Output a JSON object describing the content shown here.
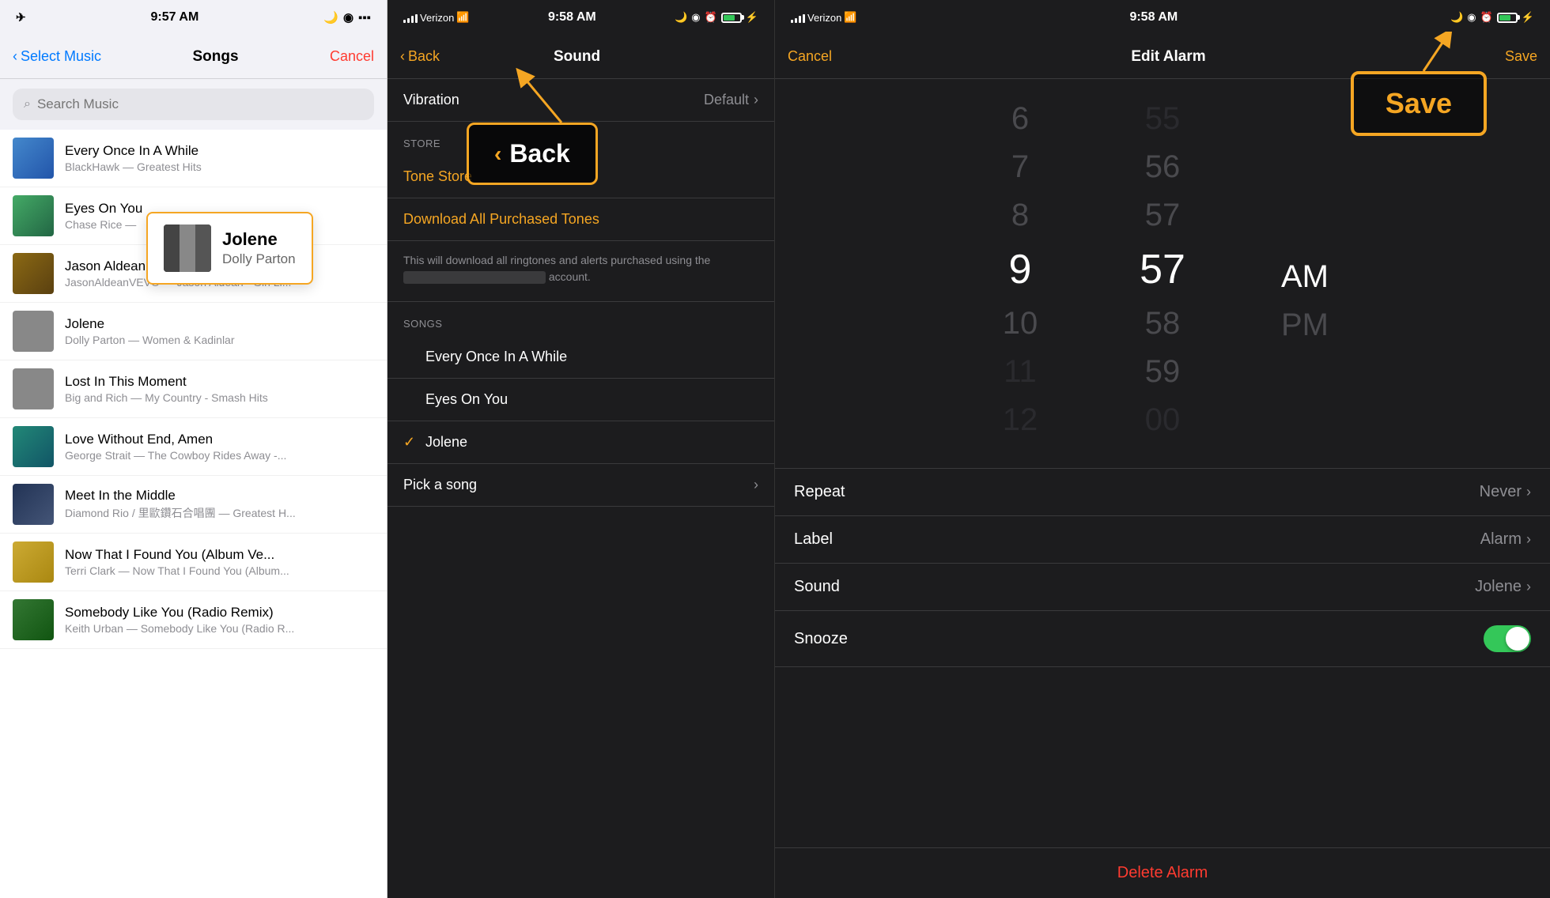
{
  "panel1": {
    "statusBar": {
      "time": "9:57 AM",
      "airplane": "✈"
    },
    "nav": {
      "back": "Select Music",
      "title": "Songs",
      "cancel": "Cancel"
    },
    "search": {
      "placeholder": "Search Music"
    },
    "songs": [
      {
        "id": "s1",
        "title": "Every Once In A While",
        "subtitle": "BlackHawk — Greatest Hits",
        "thumbColor": "thumb-blue"
      },
      {
        "id": "s2",
        "title": "Eyes On You",
        "subtitle": "Chase Rice — ...",
        "thumbColor": "thumb-green"
      },
      {
        "id": "s3",
        "title": "Jason Aldean - Girl Like You (Offi...",
        "subtitle": "JasonAldeanVEVO — Jason Aldean - Girl Li...",
        "thumbColor": "thumb-brown"
      },
      {
        "id": "s4",
        "title": "Jolene",
        "subtitle": "Dolly Parton — Women & Kadinlar",
        "thumbColor": "thumb-gray"
      },
      {
        "id": "s5",
        "title": "Lost In This Moment",
        "subtitle": "Big and Rich — My Country - Smash Hits",
        "thumbColor": "thumb-gray"
      },
      {
        "id": "s6",
        "title": "Love Without End, Amen",
        "subtitle": "George Strait — The Cowboy Rides Away -...",
        "thumbColor": "thumb-teal"
      },
      {
        "id": "s7",
        "title": "Meet In the Middle",
        "subtitle": "Diamond Rio / 里歐鑽石合唱團 — Greatest H...",
        "thumbColor": "thumb-diamond"
      },
      {
        "id": "s8",
        "title": "Now That I Found You (Album Ve...",
        "subtitle": "Terri Clark — Now That I Found You (Album...",
        "thumbColor": "thumb-yellow"
      },
      {
        "id": "s9",
        "title": "Somebody Like You (Radio Remix)",
        "subtitle": "Keith Urban — Somebody Like You (Radio R...",
        "thumbColor": "thumb-country"
      }
    ],
    "tooltip": {
      "title": "Jolene",
      "artist": "Dolly Parton"
    }
  },
  "panel2": {
    "statusBar": {
      "carrier": "Verizon",
      "time": "9:58 AM"
    },
    "nav": {
      "back": "Back",
      "title": "Sound"
    },
    "vibration": {
      "label": "Vibration",
      "value": "Default"
    },
    "sections": {
      "store": "STORE",
      "songs": "SONGS"
    },
    "toneStore": "Tone Store",
    "downloadAll": "Download All Purchased Tones",
    "description": "This will download all ringtones and alerts purchased using the account.",
    "songs": [
      {
        "id": "so1",
        "name": "Every Once In A While",
        "checked": false
      },
      {
        "id": "so2",
        "name": "Eyes On You",
        "checked": false
      },
      {
        "id": "so3",
        "name": "Jolene",
        "checked": true
      },
      {
        "id": "so4",
        "name": "Pick a song",
        "checked": false,
        "hasChevron": true
      }
    ],
    "annotations": {
      "backLabel": "Back"
    }
  },
  "panel3": {
    "statusBar": {
      "carrier": "Verizon",
      "time": "9:58 AM"
    },
    "nav": {
      "cancel": "Cancel",
      "title": "Edit Alarm",
      "save": "Save"
    },
    "timePicker": {
      "hours": [
        "6",
        "7",
        "8",
        "9",
        "10",
        "11",
        "12"
      ],
      "minutes": [
        "55",
        "56",
        "57",
        "58",
        "59",
        "00"
      ],
      "periods": [
        "AM",
        "PM"
      ],
      "selectedHour": "9",
      "selectedMinute": "57",
      "selectedPeriod": "AM"
    },
    "settings": [
      {
        "id": "repeat",
        "label": "Repeat",
        "value": "Never",
        "type": "nav"
      },
      {
        "id": "label",
        "label": "Label",
        "value": "Alarm",
        "type": "nav"
      },
      {
        "id": "sound",
        "label": "Sound",
        "value": "Jolene",
        "type": "nav"
      },
      {
        "id": "snooze",
        "label": "Snooze",
        "value": "",
        "type": "toggle",
        "enabled": true
      }
    ],
    "deleteAlarm": "Delete Alarm",
    "annotations": {
      "saveLabel": "Save"
    }
  }
}
